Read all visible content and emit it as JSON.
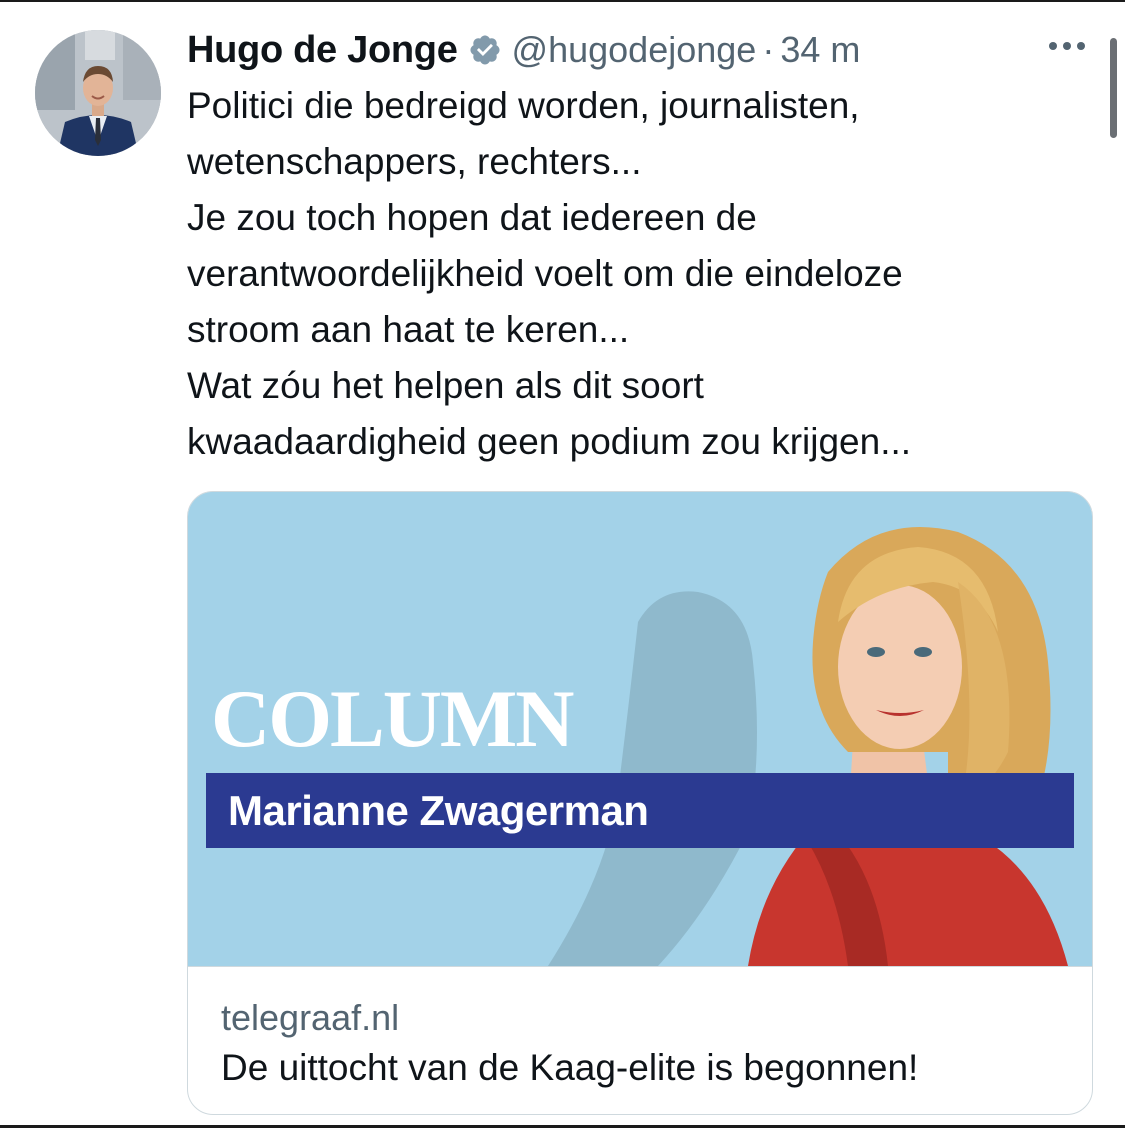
{
  "tweet": {
    "author_name": "Hugo de Jonge",
    "handle": "@hugodejonge",
    "separator": "·",
    "timestamp": "34 m",
    "text_lines": [
      "Politici die bedreigd worden, journalisten,",
      "wetenschappers, rechters...",
      "Je zou toch hopen dat iedereen de",
      "verantwoordelijkheid voelt om die eindeloze",
      "stroom aan haat te keren...",
      "Wat zóu het helpen als dit soort",
      "kwaadaardigheid geen podium zou krijgen..."
    ]
  },
  "card": {
    "image_heading": "COLUMN",
    "image_columnist": "Marianne Zwagerman",
    "domain": "telegraaf.nl",
    "title": "De uittocht van de Kaag-elite is begonnen!"
  },
  "icons": {
    "verified": "verified-badge-icon",
    "more": "more-options-icon"
  },
  "colors": {
    "text_primary": "#0f1419",
    "text_secondary": "#536471",
    "card_border": "#cfd9de",
    "card_image_bg": "#a3d2e8",
    "name_bar": "#2b3a91",
    "verified_badge": "#829aab"
  }
}
